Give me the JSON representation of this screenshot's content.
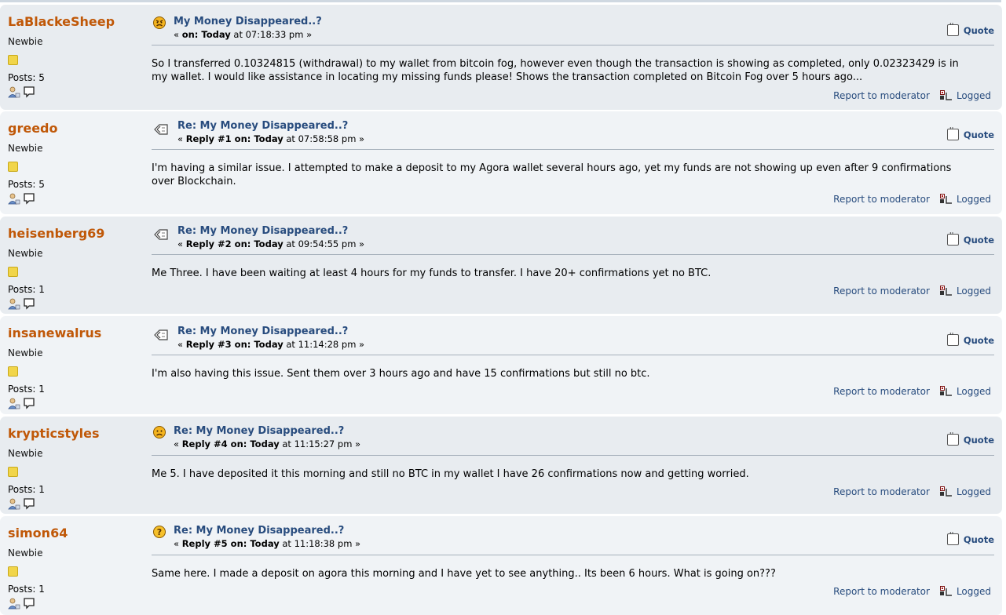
{
  "posts": [
    {
      "username": "LaBlackeSheep",
      "rank": "Newbie",
      "posts_label": "Posts: 5",
      "icon": "angry-face-icon",
      "subject": "My Money Disappeared..?",
      "meta_prefix": "« ",
      "meta_bold": "on: Today",
      "meta_time": " at 07:18:33 pm »",
      "body": "So I transferred 0.10324815 (withdrawal) to my wallet from bitcoin fog, however even though the transaction is showing as completed, only 0.02323429 is in my wallet. I would like assistance in locating my missing funds please! Shows the transaction completed on Bitcoin Fog over 5 hours ago...",
      "quote": "Quote",
      "report": "Report to moderator",
      "logged": "Logged"
    },
    {
      "username": "greedo",
      "rank": "Newbie",
      "posts_label": "Posts: 5",
      "icon": "reply-arrows-icon",
      "subject": "Re: My Money Disappeared..?",
      "meta_prefix": "« ",
      "meta_bold": "Reply #1 on: Today",
      "meta_time": " at 07:58:58 pm »",
      "body": "I'm having a similar issue. I attempted to make a deposit to my Agora wallet several hours ago, yet my funds are not showing up even after 9 confirmations over Blockchain.",
      "quote": "Quote",
      "report": "Report to moderator",
      "logged": "Logged"
    },
    {
      "username": "heisenberg69",
      "rank": "Newbie",
      "posts_label": "Posts: 1",
      "icon": "reply-arrows-icon",
      "subject": "Re: My Money Disappeared..?",
      "meta_prefix": "« ",
      "meta_bold": "Reply #2 on: Today",
      "meta_time": " at 09:54:55 pm »",
      "body": "Me Three. I have been waiting at least 4 hours for my funds to transfer. I have 20+ confirmations yet no BTC.",
      "quote": "Quote",
      "report": "Report to moderator",
      "logged": "Logged"
    },
    {
      "username": "insanewalrus",
      "rank": "Newbie",
      "posts_label": "Posts: 1",
      "icon": "reply-arrows-icon",
      "subject": "Re: My Money Disappeared..?",
      "meta_prefix": "« ",
      "meta_bold": "Reply #3 on: Today",
      "meta_time": " at 11:14:28 pm »",
      "body": "I'm also having this issue. Sent them over 3 hours ago and have 15 confirmations but still no btc.",
      "quote": "Quote",
      "report": "Report to moderator",
      "logged": "Logged"
    },
    {
      "username": "krypticstyles",
      "rank": "Newbie",
      "posts_label": "Posts: 1",
      "icon": "sad-face-icon",
      "subject": "Re: My Money Disappeared..?",
      "meta_prefix": "« ",
      "meta_bold": "Reply #4 on: Today",
      "meta_time": " at 11:15:27 pm »",
      "body": "Me 5. I have deposited it this morning and still no BTC in my wallet I have 26 confirmations now and getting worried.",
      "quote": "Quote",
      "report": "Report to moderator",
      "logged": "Logged"
    },
    {
      "username": "simon64",
      "rank": "Newbie",
      "posts_label": "Posts: 1",
      "icon": "question-icon",
      "subject": "Re: My Money Disappeared..?",
      "meta_prefix": "« ",
      "meta_bold": "Reply #5 on: Today",
      "meta_time": " at 11:18:38 pm »",
      "body": "Same here. I made a deposit on agora this morning and I have yet to see anything.. Its been 6 hours. What is going on???",
      "quote": "Quote",
      "report": "Report to moderator",
      "logged": "Logged"
    }
  ],
  "colors": {
    "username": "#c05808",
    "link": "#284c7e",
    "post_bg_odd": "#e8ecf0",
    "post_bg_even": "#f0f3f6"
  }
}
